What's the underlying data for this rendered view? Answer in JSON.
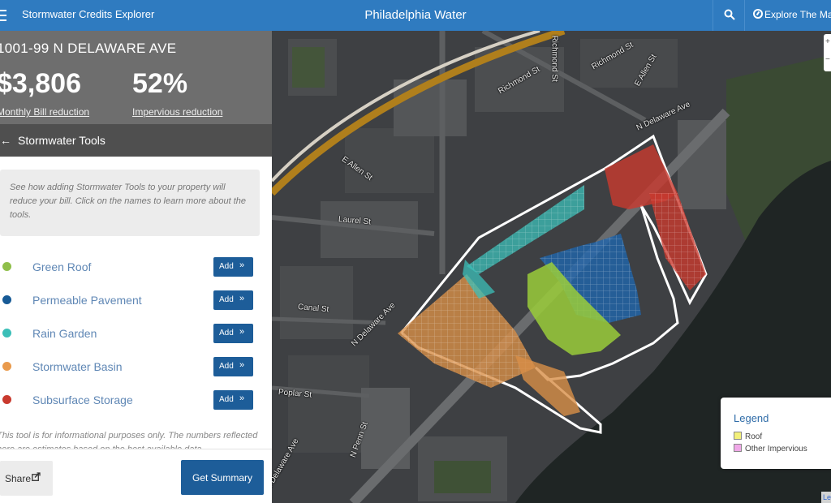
{
  "topbar": {
    "app_name": "Stormwater Credits Explorer",
    "brand": "Philadelphia Water",
    "explore_label": "Explore The Ma"
  },
  "summary": {
    "address": "1001-99 N DELAWARE AVE",
    "bill_value": "$3,806",
    "bill_label": "Monthly Bill reduction",
    "impervious_value": "52%",
    "impervious_label": "Impervious reduction"
  },
  "tools": {
    "title": "Stormwater Tools",
    "back_glyph": "←",
    "info": "See how adding Stormwater Tools to your property will reduce your bill. Click on the names to learn more about the tools.",
    "add_label": "Add",
    "add_glyph": "»",
    "items": [
      {
        "name": "Green Roof",
        "color": "#8fbf4a"
      },
      {
        "name": "Permeable Pavement",
        "color": "#175a96"
      },
      {
        "name": "Rain Garden",
        "color": "#3cbfb8"
      },
      {
        "name": "Stormwater Basin",
        "color": "#e99a4c"
      },
      {
        "name": "Subsurface Storage",
        "color": "#c93a2e"
      }
    ],
    "disclaimer": "This tool is for informational purposes only. The numbers reflected here are estimates based on the best available data"
  },
  "footer": {
    "share_label": "Share",
    "summary_label": "Get Summary"
  },
  "map": {
    "streets": {
      "richmond_1": "Richmond St",
      "richmond_2": "Richmond St",
      "richmond_3": "Richmond St",
      "allen_1": "E Allen St",
      "allen_2": "E Allen St",
      "delaware_1": "N Delaware Ave",
      "delaware_2": "N Delaware Ave",
      "delaware_3": "N Delaware Ave",
      "laurel": "Laurel St",
      "canal": "Canal St",
      "poplar": "Poplar St",
      "penn": "N Penn St"
    },
    "zoom_in": "+",
    "zoom_out": "−",
    "legend": {
      "title": "Legend",
      "items": [
        {
          "label": "Roof",
          "color": "#f3f07a"
        },
        {
          "label": "Other Impervious",
          "color": "#f0a8e8"
        }
      ]
    },
    "attribution": "Le",
    "colors": {
      "land": "#3e4043",
      "river": "#1f2524",
      "parcel_outline": "#ffffff",
      "highway": "#b07f1c"
    }
  }
}
